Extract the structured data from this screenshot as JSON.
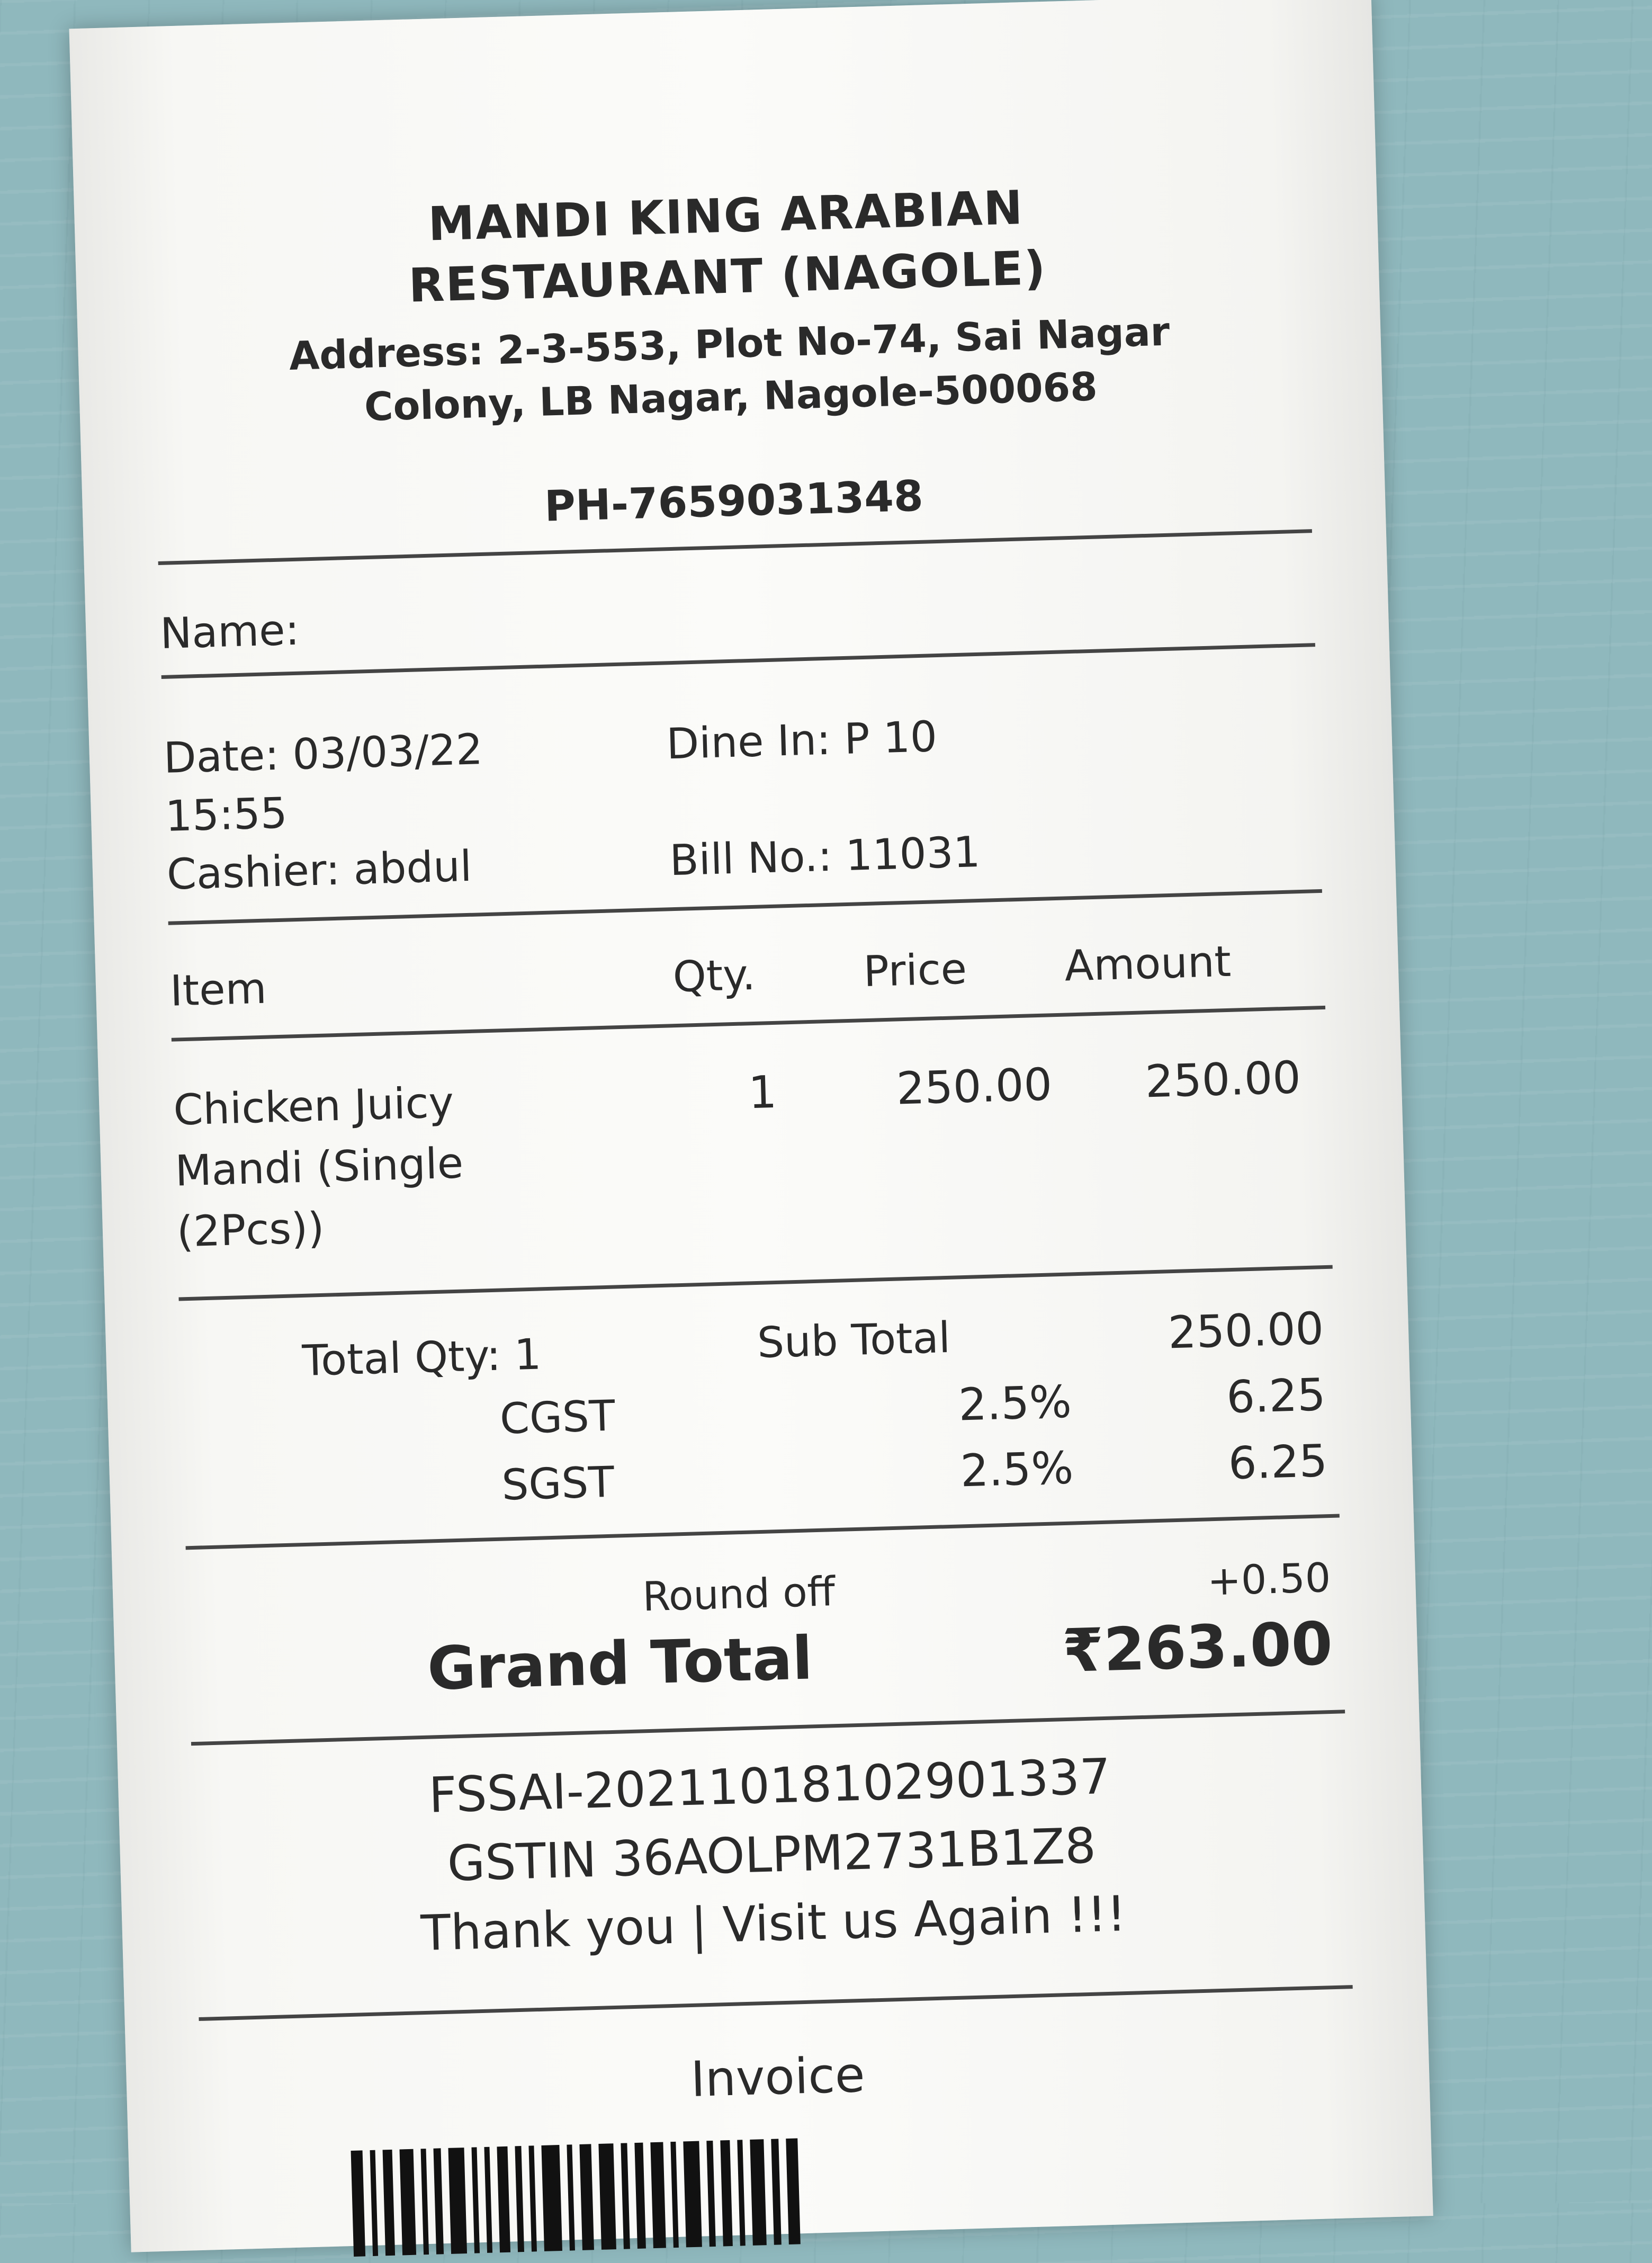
{
  "header": {
    "title_line1": "MANDI KING ARABIAN",
    "title_line2": "RESTAURANT (NAGOLE)",
    "address": "Address: 2-3-553, Plot No-74, Sai Nagar Colony, LB Nagar, Nagole-500068",
    "phone": "PH-7659031348"
  },
  "customer": {
    "name_label": "Name:"
  },
  "meta": {
    "date_label": "Date: 03/03/22",
    "time": "15:55",
    "dine_in": "Dine In: P 10",
    "cashier": "Cashier: abdul",
    "bill_no": "Bill No.: 11031"
  },
  "columns": {
    "item": "Item",
    "qty": "Qty.",
    "price": "Price",
    "amount": "Amount"
  },
  "items": [
    {
      "name_line1": "Chicken Juicy",
      "name_line2": "Mandi (Single",
      "name_line3": "(2Pcs))",
      "qty": "1",
      "price": "250.00",
      "amount": "250.00"
    }
  ],
  "totals": {
    "total_qty": "Total Qty: 1",
    "subtotal_label": "Sub Total",
    "subtotal": "250.00",
    "cgst_label": "CGST",
    "cgst_rate": "2.5%",
    "cgst": "6.25",
    "sgst_label": "SGST",
    "sgst_rate": "2.5%",
    "sgst": "6.25",
    "round_off_label": "Round off",
    "round_off": "+0.50",
    "grand_label": "Grand Total",
    "grand_total": "₹263.00"
  },
  "footer": {
    "fssai": "FSSAI-20211018102901337",
    "gstin": "GSTIN 36AOLPM2731B1Z8",
    "thanks": "Thank you | Visit us Again !!!",
    "invoice": "Invoice"
  }
}
